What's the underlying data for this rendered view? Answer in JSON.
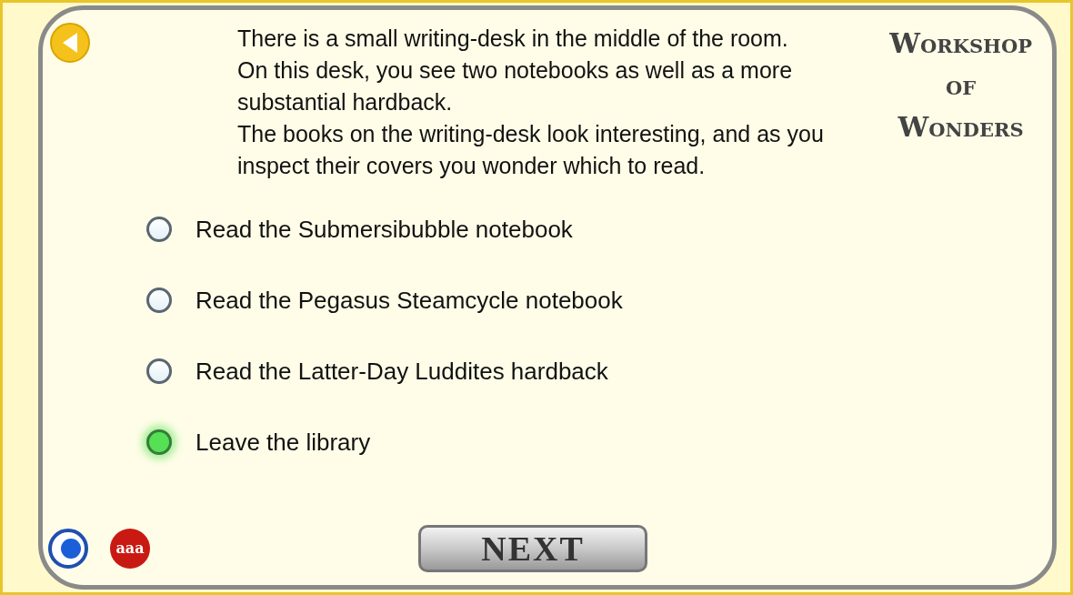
{
  "title": [
    "Workshop",
    "of",
    "Wonders"
  ],
  "paragraphs": [
    "There is a small writing-desk in the middle of the room.",
    "On this desk, you see two notebooks as well as a more substantial hardback.",
    "The books on the writing-desk look interesting, and as you inspect their covers you wonder which to read."
  ],
  "choices": [
    {
      "label": "Read the Submersibubble notebook",
      "selected": false
    },
    {
      "label": "Read the Pegasus Steamcycle notebook",
      "selected": false
    },
    {
      "label": "Read the Latter-Day Luddites hardback",
      "selected": false
    },
    {
      "label": "Leave the library",
      "selected": true
    }
  ],
  "text_size_button": "aaa",
  "next_button": "NEXT"
}
